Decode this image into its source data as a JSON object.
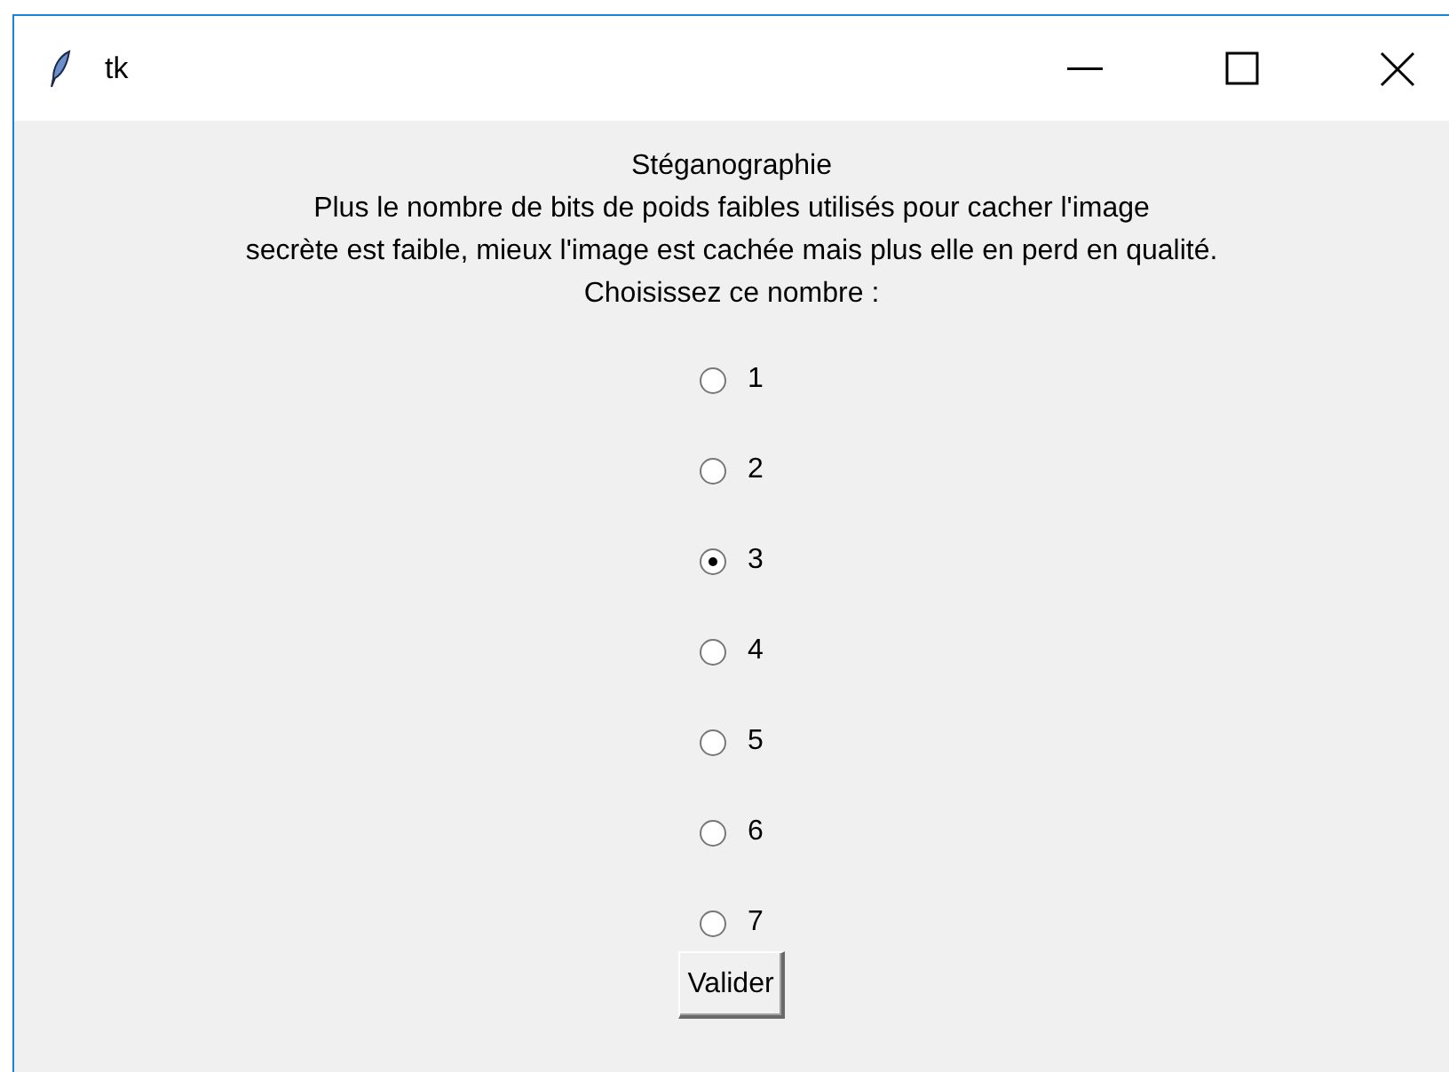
{
  "window": {
    "title": "tk"
  },
  "lines": [
    "Stéganographie",
    "Plus le nombre de bits de poids faibles utilisés pour cacher l'image",
    "secrète est faible, mieux l'image est cachée mais plus elle en perd en qualité.",
    "Choisissez ce nombre :"
  ],
  "options": [
    {
      "label": "1",
      "selected": false
    },
    {
      "label": "2",
      "selected": false
    },
    {
      "label": "3",
      "selected": true
    },
    {
      "label": "4",
      "selected": false
    },
    {
      "label": "5",
      "selected": false
    },
    {
      "label": "6",
      "selected": false
    },
    {
      "label": "7",
      "selected": false
    }
  ],
  "button": "Valider"
}
